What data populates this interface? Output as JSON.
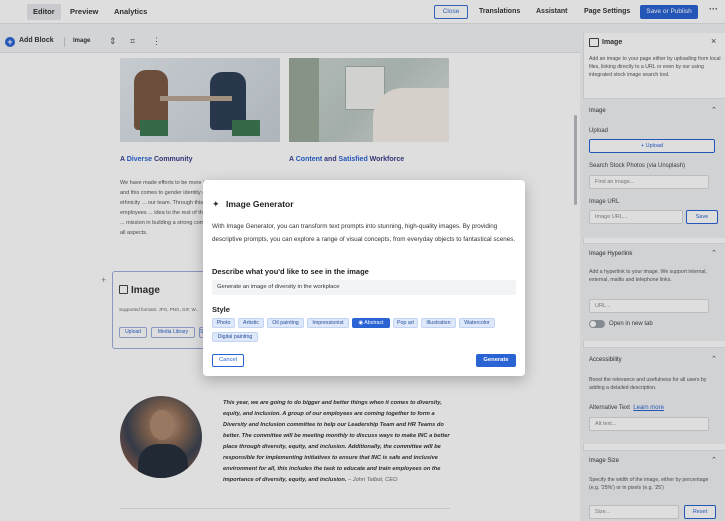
{
  "topbar": {
    "tabs": [
      "Editor",
      "Preview",
      "Analytics"
    ],
    "close_label": "Close",
    "translations_label": "Translations",
    "assistant_label": "Assistant",
    "page_settings_label": "Page Settings",
    "publish_label": "Save or Publish",
    "more_label": "···"
  },
  "toolbar": {
    "add_block_label": "Add Block",
    "image_label": "Image"
  },
  "content": {
    "col1_title_prefix": "A ",
    "col1_title_hl": "Diverse",
    "col1_title_suffix": " Community",
    "col2_title_prefix": "A ",
    "col2_title_hl1": "Content",
    "col2_title_mid": " and ",
    "col2_title_hl2": "Satisfied",
    "col2_title_suffix": " Workforce",
    "col1_body": "We have made efforts to be more inclusive and this comes to gender identity and ethnicity ... our team. Through this group, employees ... idea to the rest of the company ... mission in building a strong community ... all aspects.",
    "image_block_title": "Image",
    "image_block_sub": "Supported formats: JPG, PNG, GIF, W...",
    "image_block_buttons": [
      "Upload",
      "Media Library",
      "Stock"
    ],
    "quote_text": "This year, we are going to do bigger and better things when it comes to diversity, equity, and inclusion. A group of our employees are coming together to form a Diversity and Inclusion committee to help our Leadership Team and HR Teams do better. The committee will be meeting monthly to discuss ways to make INC a better place through diversity, equity, and inclusion. Additionally, the committee will be responsible for implementing initiatives to ensure that INC is safe and inclusive environment for all, this includes the task to educate and train employees on the importance of diversity, equity, and inclusion.",
    "quote_author": " – John Talbot, CEO"
  },
  "panel": {
    "title": "Image",
    "close": "×",
    "desc": "Add an image to your page either by uploading from local files, linking directly to a URL or even by our using integrated stock image search tool.",
    "image_section": {
      "title": "Image",
      "upload_label": "Upload",
      "upload_button": "+ Upload",
      "stock_label": "Search Stock Photos (via Unsplash)",
      "stock_placeholder": "Find an image...",
      "url_label": "Image URL",
      "url_placeholder": "Image URL...",
      "save_button": "Save"
    },
    "hyperlink_section": {
      "title": "Image Hyperlink",
      "desc": "Add a hyperlink to your image. We support internal, external, mailto and telephone links.",
      "url_placeholder": "URL...",
      "toggle_label": "Open in new tab"
    },
    "accessibility_section": {
      "title": "Accessibility",
      "desc": "Boost the relevance and usefulness for all users by adding a detailed description.",
      "alt_label": "Alternative Text",
      "learn_more": "Learn more",
      "alt_placeholder": "Alt text..."
    },
    "size_section": {
      "title": "Image Size",
      "desc": "Specify the width of the image, either by percentage (e.g. '25%') or in pixels (e.g. '25')",
      "size_placeholder": "Size...",
      "reset_button": "Reset"
    }
  },
  "modal": {
    "title": "Image Generator",
    "description": "With Image Generator, you can transform text prompts into stunning, high-quality images. By providing descriptive prompts, you can explore a range of visual concepts, from everyday objects to fantastical scenes.",
    "prompt_label": "Describe what you'd like to see in the image",
    "prompt_value": "Generate an image of diversity in the workplace",
    "style_label": "Style",
    "styles": [
      "Photo",
      "Artistic",
      "Oil painting",
      "Impressionist",
      "Abstract",
      "Pop art",
      "Illustration",
      "Watercolor",
      "Digital painting"
    ],
    "selected_style": "Abstract",
    "cancel_label": "Cancel",
    "generate_label": "Generate"
  }
}
